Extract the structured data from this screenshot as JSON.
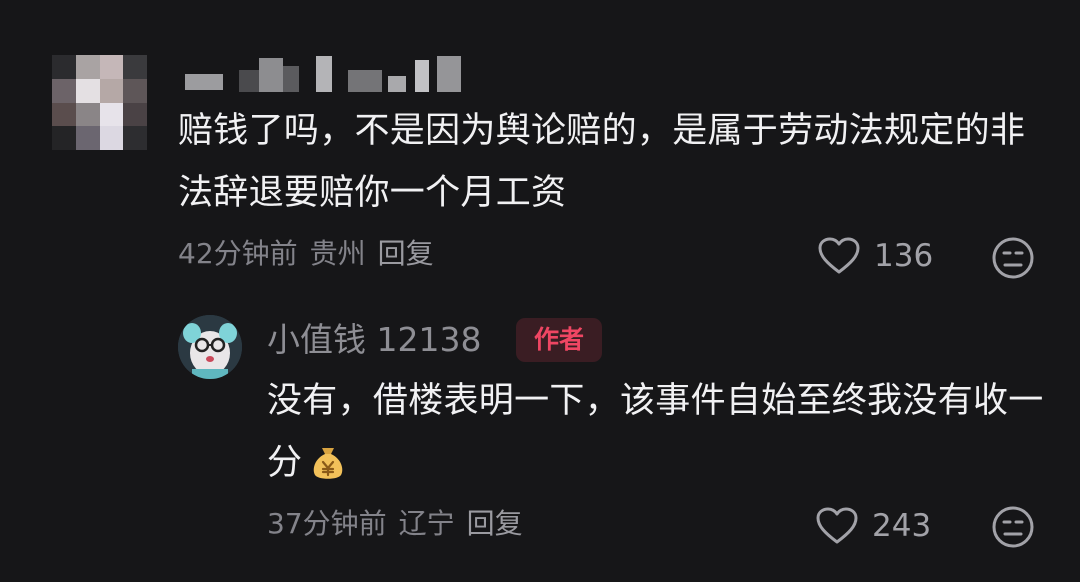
{
  "comment": {
    "avatar_icon": "pixelated-avatar-icon",
    "username_icon": "pixelated-username",
    "text": "赔钱了吗，不是因为舆论赔的，是属于劳动法规定的非法辞退要赔你一个月工资",
    "time": "42分钟前",
    "location": "贵州",
    "reply_label": "回复",
    "like_count": "136",
    "colors": {
      "background": "#161618",
      "text": "#f1f1f3",
      "meta": "#83838a"
    }
  },
  "reply": {
    "avatar_icon": "cartoon-avatar-icon",
    "username": "小值钱 12138",
    "author_badge": "作者",
    "text": "没有，借楼表明一下，该事件自始至终我没有收一分",
    "emoji": "money-bag-icon",
    "time": "37分钟前",
    "location": "辽宁",
    "reply_label": "回复",
    "like_count": "243",
    "colors": {
      "badge_bg": "#3a1d23",
      "badge_text": "#ef4663"
    }
  }
}
